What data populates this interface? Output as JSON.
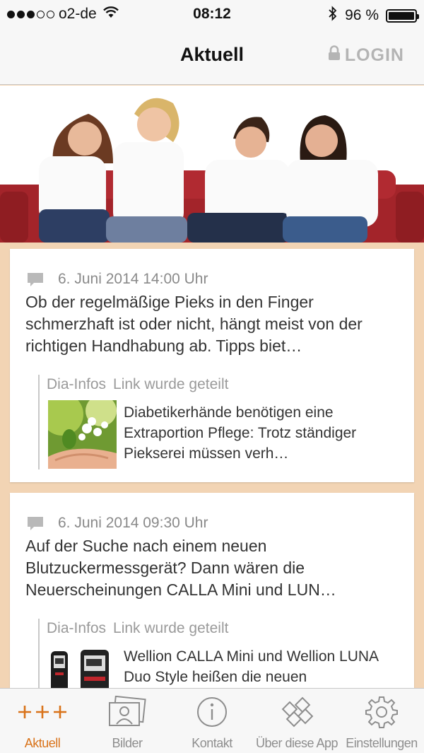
{
  "status_bar": {
    "carrier": "o2-de",
    "time": "08:12",
    "battery": "96 %"
  },
  "nav": {
    "title": "Aktuell",
    "login": "LOGIN"
  },
  "posts": [
    {
      "date": "6. Juni 2014 14:00 Uhr",
      "text": "Ob der regelmäßige Pieks in den Finger schmerzhaft ist oder nicht, hängt meist von der richtigen Handhabung ab. Tipps biet…",
      "share_source": "Dia-Infos",
      "share_note": "Link wurde geteilt",
      "share_text": "Diabetikerhände benötigen eine Extraportion Pflege: Trotz ständiger Piekserei müssen verh…"
    },
    {
      "date": "6. Juni 2014 09:30 Uhr",
      "text": "Auf der Suche nach einem neuen Blutzuckermessgerät? Dann wären die Neuerscheinungen CALLA Mini und LUN…",
      "share_source": "Dia-Infos",
      "share_note": "Link wurde geteilt",
      "share_text": "Wellion CALLA Mini und Wellion LUNA Duo Style heißen die neuen"
    }
  ],
  "tabs": [
    {
      "label": "Aktuell",
      "icon": "plus-icon"
    },
    {
      "label": "Bilder",
      "icon": "picture-icon"
    },
    {
      "label": "Kontakt",
      "icon": "info-icon"
    },
    {
      "label": "Über diese App",
      "icon": "app-icon"
    },
    {
      "label": "Einstellungen",
      "icon": "gear-icon"
    }
  ],
  "colors": {
    "accent": "#d9731a",
    "feed_background": "#f2d4b4",
    "inactive_tab": "#8e8e8e"
  }
}
